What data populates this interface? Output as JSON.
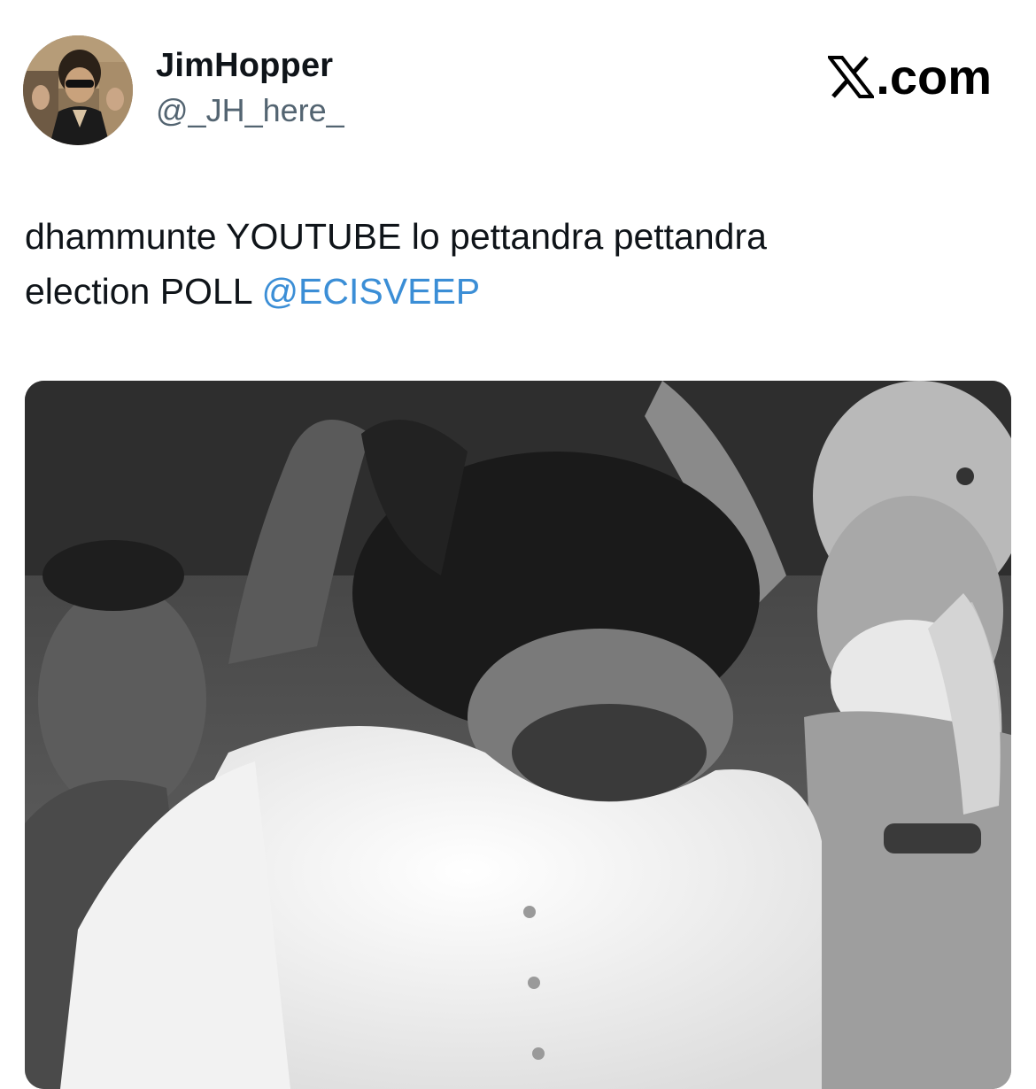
{
  "tweet": {
    "author": {
      "display_name": "JimHopper",
      "handle": "@_JH_here_"
    },
    "site_badge": {
      "icon": "x-logo-icon",
      "text": ".com"
    },
    "text": {
      "line1": "dhammunte YOUTUBE lo pettandra pettandra",
      "line2_prefix": "election POLL",
      "mention": "@ECISVEEP"
    },
    "media": {
      "type": "video-frame",
      "style": "grayscale photo"
    }
  },
  "colors": {
    "text": "#0f1419",
    "secondary_text": "#536471",
    "link": "#3b8ed6",
    "background": "#ffffff"
  }
}
